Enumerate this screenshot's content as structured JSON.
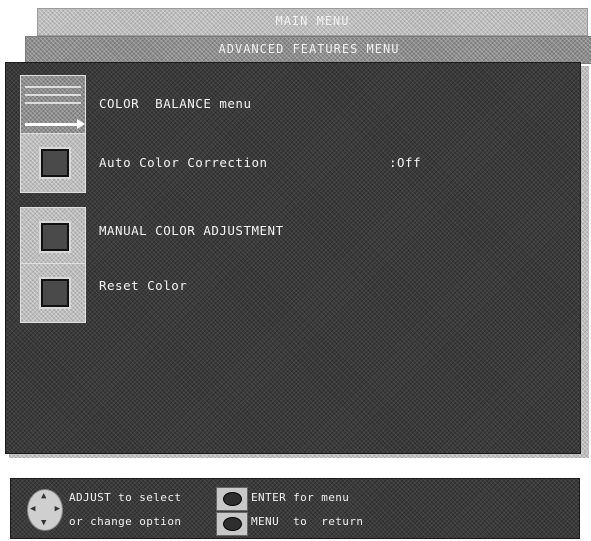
{
  "windows": {
    "main_title": "MAIN MENU",
    "advanced_title": "ADVANCED FEATURES MENU"
  },
  "menu": {
    "items": [
      {
        "label": "COLOR  BALANCE menu",
        "value": "",
        "icon": "color-balance-icon"
      },
      {
        "label": "Auto Color Correction",
        "value": ":Off",
        "icon": "square-button-icon"
      },
      {
        "label": "MANUAL COLOR ADJUSTMENT",
        "value": "",
        "icon": "square-button-icon"
      },
      {
        "label": "Reset Color",
        "value": "",
        "icon": "square-button-icon"
      }
    ]
  },
  "help": {
    "adjust_line1": "ADJUST to select",
    "adjust_line2": "or change option",
    "enter_text": "ENTER for menu",
    "menu_text": "MENU  to  return",
    "joystick_icon": "joystick-icon",
    "enter_icon": "enter-button-icon",
    "menu_icon": "menu-button-icon"
  }
}
